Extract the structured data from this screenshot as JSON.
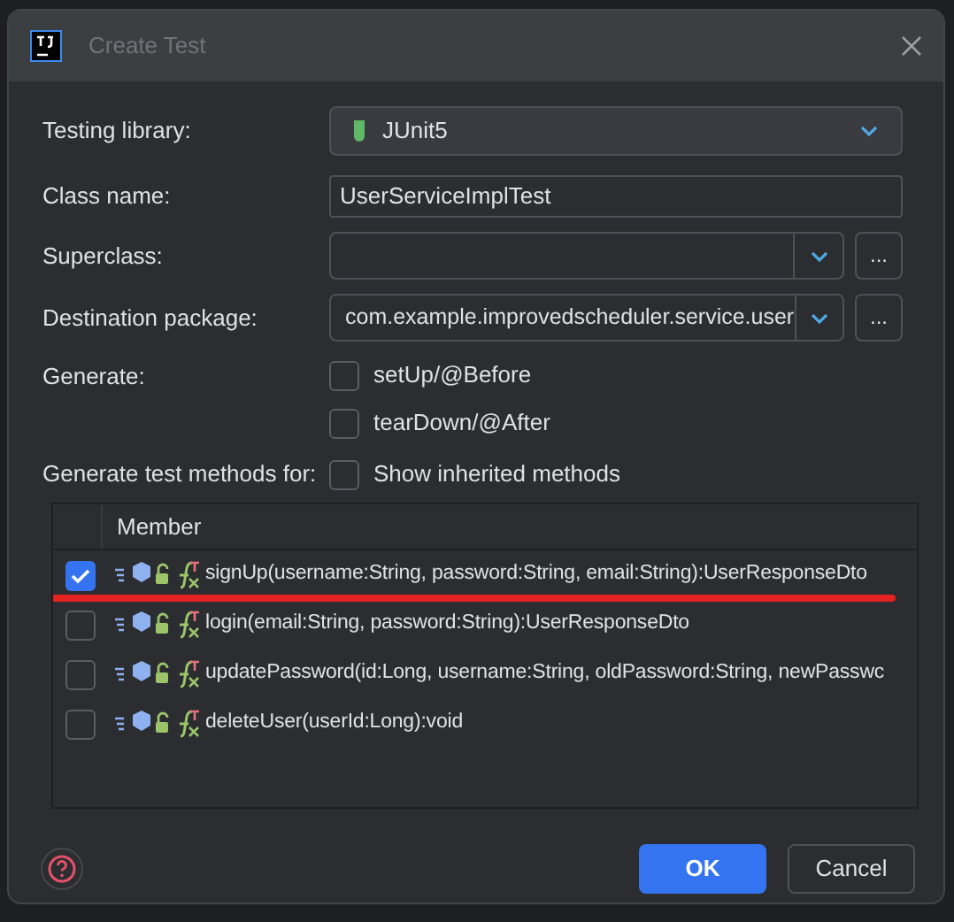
{
  "window": {
    "title": "Create Test"
  },
  "form": {
    "testing_library": {
      "label": "Testing library:",
      "value": "JUnit5"
    },
    "class_name": {
      "label": "Class name:",
      "value": "UserServiceImplTest"
    },
    "superclass": {
      "label": "Superclass:"
    },
    "destination_package": {
      "label": "Destination package:",
      "value": "com.example.improvedscheduler.service.user"
    },
    "browse_label": "...",
    "generate": {
      "label": "Generate:",
      "options": [
        {
          "label": "setUp/@Before",
          "checked": false
        },
        {
          "label": "tearDown/@After",
          "checked": false
        }
      ]
    },
    "methods_for": {
      "label": "Generate test methods for:",
      "option": {
        "label": "Show inherited methods",
        "checked": false
      }
    }
  },
  "table": {
    "columns": [
      "Member"
    ],
    "rows": [
      {
        "signature": "signUp(username:String, password:String, email:String):UserResponseDto",
        "checked": true,
        "annotated": true
      },
      {
        "signature": "login(email:String, password:String):UserResponseDto",
        "checked": false,
        "annotated": false
      },
      {
        "signature": "updatePassword(id:Long, username:String, oldPassword:String, newPasswc",
        "checked": false,
        "annotated": false
      },
      {
        "signature": "deleteUser(userId:Long):void",
        "checked": false,
        "annotated": false
      }
    ]
  },
  "buttons": [
    {
      "label": "OK",
      "primary": true
    },
    {
      "label": "Cancel",
      "primary": false
    }
  ]
}
